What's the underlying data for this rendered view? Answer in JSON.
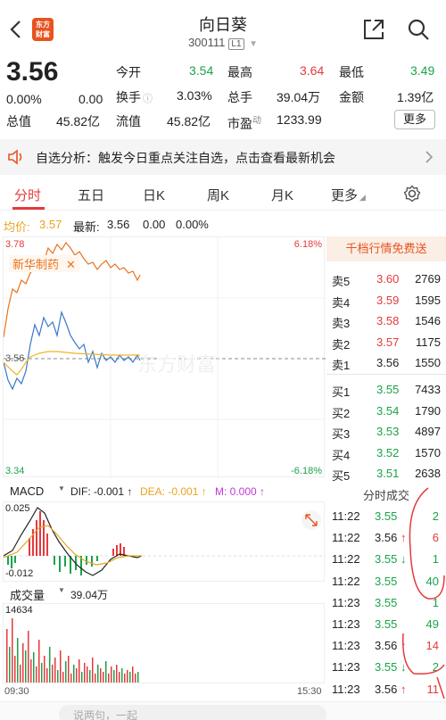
{
  "header": {
    "logo_text": "东方财富",
    "title": "向日葵",
    "code": "300111",
    "level": "L1"
  },
  "quote": {
    "price": "3.56",
    "change_pct": "0.00%",
    "change": "0.00",
    "fields": [
      {
        "label": "今开",
        "value": "3.54",
        "color": "green"
      },
      {
        "label": "最高",
        "value": "3.64",
        "color": "red"
      },
      {
        "label": "最低",
        "value": "3.49",
        "color": "green"
      },
      {
        "label": "换手",
        "value": "3.03%",
        "color": "dark"
      },
      {
        "label": "总手",
        "value": "39.04万",
        "color": "dark"
      },
      {
        "label": "金额",
        "value": "1.39亿",
        "color": "dark"
      },
      {
        "label": "总值",
        "value": "45.82亿",
        "color": "dark"
      },
      {
        "label": "流值",
        "value": "45.82亿",
        "color": "dark"
      },
      {
        "label": "市盈",
        "value": "1233.99",
        "color": "dark"
      }
    ],
    "pe_superscript": "动",
    "more_label": "更多"
  },
  "banner": {
    "text": "自选分析：触发今日重点关注自选，点击查看最新机会"
  },
  "tabs": [
    "分时",
    "五日",
    "日K",
    "周K",
    "月K",
    "更多"
  ],
  "avg_bar": {
    "avg_label": "均价:",
    "avg_value": "3.57",
    "latest_label": "最新:",
    "latest_value": "3.56",
    "latest_change": "0.00",
    "latest_pct": "0.00%"
  },
  "chart_data": {
    "type": "line",
    "y_top": "3.78",
    "y_mid": "3.56",
    "y_bottom": "3.34",
    "pct_top": "6.18%",
    "pct_bottom": "-6.18%",
    "compare_label": "新华制药",
    "x_start": "09:30",
    "x_end": "15:30",
    "watermark": "东方财富"
  },
  "order_book": {
    "promo": "千档行情免费送",
    "sell": [
      {
        "label": "卖5",
        "price": "3.60",
        "vol": "2769",
        "color": "red"
      },
      {
        "label": "卖4",
        "price": "3.59",
        "vol": "1595",
        "color": "red"
      },
      {
        "label": "卖3",
        "price": "3.58",
        "vol": "1546",
        "color": "red"
      },
      {
        "label": "卖2",
        "price": "3.57",
        "vol": "1175",
        "color": "red"
      },
      {
        "label": "卖1",
        "price": "3.56",
        "vol": "1550",
        "color": "dark"
      }
    ],
    "buy": [
      {
        "label": "买1",
        "price": "3.55",
        "vol": "7433",
        "color": "green"
      },
      {
        "label": "买2",
        "price": "3.54",
        "vol": "1790",
        "color": "green"
      },
      {
        "label": "买3",
        "price": "3.53",
        "vol": "4897",
        "color": "green"
      },
      {
        "label": "买4",
        "price": "3.52",
        "vol": "1570",
        "color": "green"
      },
      {
        "label": "买5",
        "price": "3.51",
        "vol": "2638",
        "color": "green"
      }
    ]
  },
  "macd": {
    "name": "MACD",
    "dif": "DIF: -0.001 ↑",
    "dea": "DEA: -0.001 ↑",
    "m": "M: 0.000 ↑",
    "top": "0.025",
    "bottom": "-0.012"
  },
  "volume": {
    "name": "成交量",
    "value": "39.04万",
    "max": "14634"
  },
  "trades": {
    "title": "分时成交",
    "rows": [
      {
        "time": "11:22",
        "price": "3.55",
        "arrow": "",
        "vol": "2",
        "pcolor": "green",
        "vcolor": "green"
      },
      {
        "time": "11:22",
        "price": "3.56",
        "arrow": "↑",
        "vol": "6",
        "pcolor": "dark",
        "vcolor": "red"
      },
      {
        "time": "11:22",
        "price": "3.55",
        "arrow": "↓",
        "vol": "1",
        "pcolor": "green",
        "vcolor": "green"
      },
      {
        "time": "11:22",
        "price": "3.55",
        "arrow": "",
        "vol": "40",
        "pcolor": "green",
        "vcolor": "green"
      },
      {
        "time": "11:23",
        "price": "3.55",
        "arrow": "",
        "vol": "1",
        "pcolor": "green",
        "vcolor": "green"
      },
      {
        "time": "11:23",
        "price": "3.55",
        "arrow": "",
        "vol": "49",
        "pcolor": "green",
        "vcolor": "green"
      },
      {
        "time": "11:23",
        "price": "3.56",
        "arrow": "↑",
        "vol": "14",
        "pcolor": "dark",
        "vcolor": "red"
      },
      {
        "time": "11:23",
        "price": "3.55",
        "arrow": "↓",
        "vol": "2",
        "pcolor": "green",
        "vcolor": "green"
      },
      {
        "time": "11:23",
        "price": "3.56",
        "arrow": "↑",
        "vol": "11",
        "pcolor": "dark",
        "vcolor": "red"
      }
    ]
  },
  "bottom": {
    "placeholder": "说两句，一起"
  },
  "colors": {
    "red": "#e6393d",
    "green": "#1aa34a",
    "accent": "#e8531f",
    "price_line": "#e8741f",
    "compare_line": "#3a78c9",
    "avg_line": "#f0b429"
  }
}
